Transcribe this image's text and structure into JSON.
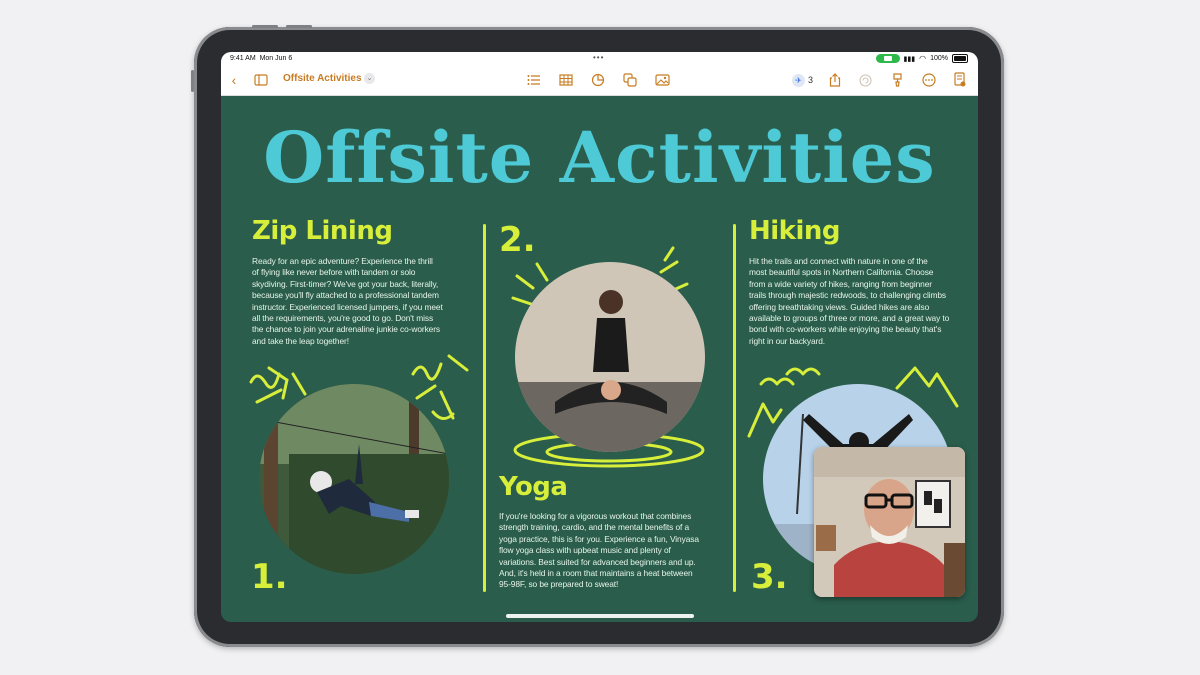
{
  "status_bar": {
    "time": "9:41 AM",
    "date": "Mon Jun 6",
    "battery": "100%"
  },
  "toolbar": {
    "back_icon": "chevron-left-icon",
    "document_title": "Offsite Activities",
    "collaborators_count": "3",
    "accent_color": "#c77b22"
  },
  "document": {
    "title": "Offsite Activities",
    "colors": {
      "background": "#2a5d4b",
      "title": "#4ec9d6",
      "headings": "#d7ee3a",
      "body": "#e6f4ea"
    },
    "sections": [
      {
        "heading": "Zip Lining",
        "number": "1.",
        "lines": [
          "Ready for an epic adventure? Experience the thrill",
          "of flying like never before with tandem or solo",
          "skydiving. First-timer? We've got your back, literally,",
          "because you'll fly attached to a professional tandem",
          "instructor. Experienced licensed jumpers, if you meet",
          "all the requirements, you're good to go. Don't miss",
          "the chance to join your adrenaline junkie co-workers",
          "and take the leap together!"
        ]
      },
      {
        "heading": "Yoga",
        "number": "2.",
        "lines": [
          "If you're looking for a vigorous workout that combines",
          "strength training, cardio, and the mental benefits of a",
          "yoga practice, this is for you. Experience a fun, Vinyasa",
          "flow yoga class with upbeat music and plenty of",
          "variations. Best suited for  advanced beginners and up.",
          "And, it's held in a room that maintains a heat between",
          "95-98F, so be prepared to sweat!"
        ]
      },
      {
        "heading": "Hiking",
        "number": "3.",
        "lines": [
          "Hit the trails and connect with nature in one of the",
          "most beautiful spots in Northern California. Choose",
          "from a wide variety of hikes, ranging from beginner",
          "trails through majestic redwoods, to challenging climbs",
          "offering breathtaking views. Guided hikes are also",
          "available to groups of three or more, and a great way to",
          "bond with co-workers while enjoying the beauty that's",
          "right in our backyard."
        ]
      }
    ]
  },
  "facetime_tile": {
    "icon": "person-video-icon"
  }
}
